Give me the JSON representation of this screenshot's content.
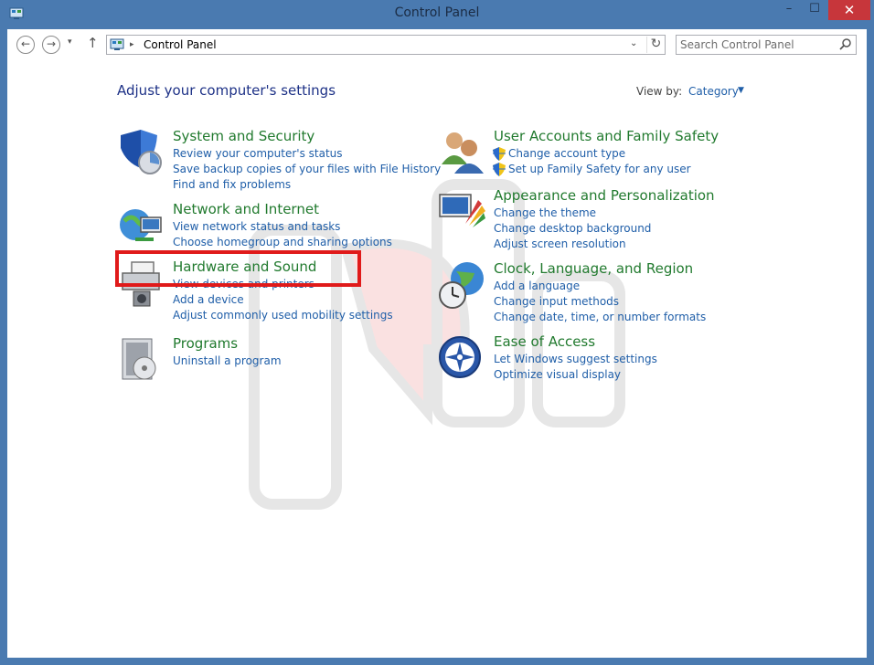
{
  "window": {
    "title": "Control Panel",
    "min_glyph": "–",
    "max_glyph": "☐",
    "close_glyph": "✕"
  },
  "nav": {
    "back_glyph": "←",
    "forward_glyph": "→",
    "recent_glyph": "▾",
    "up_glyph": "↑"
  },
  "address": {
    "separator": "▸",
    "crumb": "Control Panel",
    "dropdown_glyph": "⌄",
    "refresh_glyph": "↻"
  },
  "search": {
    "placeholder": "Search Control Panel"
  },
  "main": {
    "heading": "Adjust your computer's settings",
    "view_by_label": "View by:",
    "view_by_value": "Category",
    "view_by_arrow": "▼"
  },
  "categories": {
    "system_security": {
      "title": "System and Security",
      "links": [
        "Review your computer's status",
        "Save backup copies of your files with File History",
        "Find and fix problems"
      ]
    },
    "network": {
      "title": "Network and Internet",
      "links": [
        "View network status and tasks",
        "Choose homegroup and sharing options"
      ]
    },
    "hardware": {
      "title": "Hardware and Sound",
      "links": [
        "View devices and printers",
        "Add a device",
        "Adjust commonly used mobility settings"
      ]
    },
    "programs": {
      "title": "Programs",
      "links": [
        "Uninstall a program"
      ]
    },
    "user_accounts": {
      "title": "User Accounts and Family Safety",
      "links": [
        "Change account type",
        "Set up Family Safety for any user"
      ]
    },
    "appearance": {
      "title": "Appearance and Personalization",
      "links": [
        "Change the theme",
        "Change desktop background",
        "Adjust screen resolution"
      ]
    },
    "clock": {
      "title": "Clock, Language, and Region",
      "links": [
        "Add a language",
        "Change input methods",
        "Change date, time, or number formats"
      ]
    },
    "ease": {
      "title": "Ease of Access",
      "links": [
        "Let Windows suggest settings",
        "Optimize visual display"
      ]
    }
  },
  "colors": {
    "frame": "#4a7ab0",
    "category_title": "#217a2e",
    "link": "#1f5ea8",
    "heading": "#1e3287",
    "highlight": "#e01a1a",
    "close_button": "#c7363b"
  }
}
